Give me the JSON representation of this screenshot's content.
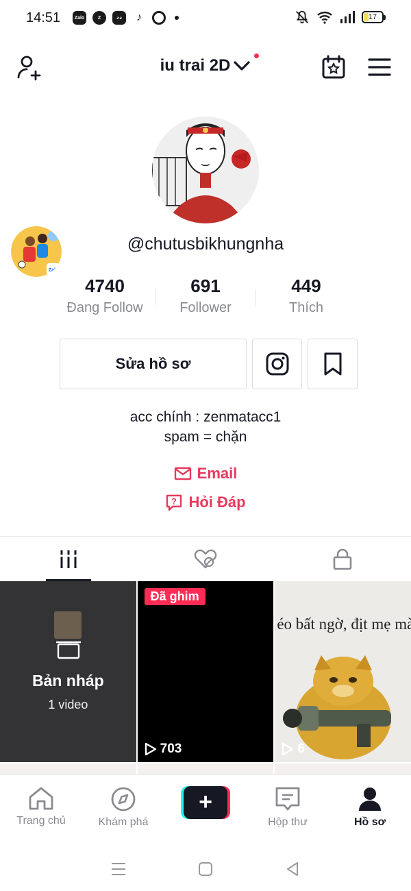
{
  "status_bar": {
    "time": "14:51",
    "app_icons": [
      "zalo-icon",
      "zalo-z-icon",
      "messenger-bot-icon",
      "tiktok-icon",
      "chrome-icon"
    ],
    "battery": "17"
  },
  "header": {
    "title": "iu trai 2D",
    "add_friend_icon": "add-person-icon",
    "calendar_icon": "calendar-star-icon",
    "menu_icon": "hamburger-icon"
  },
  "profile": {
    "username": "@chutusbikhungnha",
    "side_badge_label": "Zalo",
    "stats": [
      {
        "num": "4740",
        "label": "Đang Follow"
      },
      {
        "num": "691",
        "label": "Follower"
      },
      {
        "num": "449",
        "label": "Thích"
      }
    ],
    "edit_button": "Sửa hồ sơ",
    "bio_lines": [
      "acc chính : zenmatacc1",
      "spam = chặn"
    ],
    "email_label": "Email",
    "faq_label": "Hỏi Đáp"
  },
  "tabs": [
    "videos-grid-icon",
    "liked-hidden-icon",
    "lock-icon"
  ],
  "grid": {
    "drafts_title": "Bản nháp",
    "drafts_count": "1 video",
    "pinned_badge": "Đã ghim",
    "pinned_views": "703",
    "meme_text": "éo bất ngờ, địt mẹ mày",
    "meme_views": "6"
  },
  "bottom_nav": [
    {
      "label": "Trang chủ",
      "icon": "home-icon"
    },
    {
      "label": "Khám phá",
      "icon": "compass-icon"
    },
    {
      "label": "",
      "icon": "plus-icon"
    },
    {
      "label": "Hộp thư",
      "icon": "inbox-icon"
    },
    {
      "label": "Hồ sơ",
      "icon": "profile-icon"
    }
  ],
  "colors": {
    "accent": "#fe2c55",
    "link": "#e8395b",
    "text": "#161823",
    "muted": "#8a8b91"
  }
}
